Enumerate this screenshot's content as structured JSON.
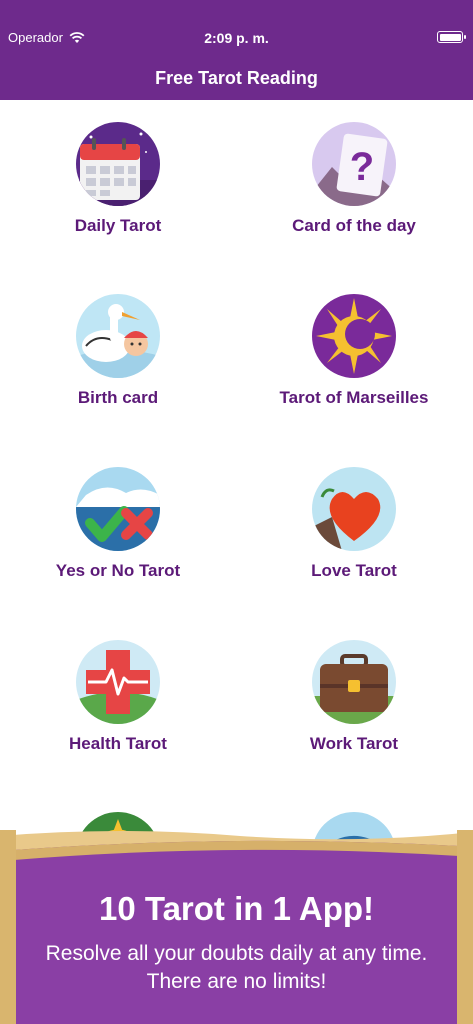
{
  "status_bar": {
    "carrier": "Operador",
    "time": "2:09 p. m."
  },
  "nav": {
    "title": "Free Tarot Reading"
  },
  "tiles": [
    {
      "label": "Daily Tarot"
    },
    {
      "label": "Card of the day"
    },
    {
      "label": "Birth card"
    },
    {
      "label": "Tarot of Marseilles"
    },
    {
      "label": "Yes or No Tarot"
    },
    {
      "label": "Love Tarot"
    },
    {
      "label": "Health Tarot"
    },
    {
      "label": "Work Tarot"
    }
  ],
  "banner": {
    "title": "10 Tarot in 1 App!",
    "subtitle_line1": "Resolve all your doubts daily at any time.",
    "subtitle_line2": "There are no limits!"
  },
  "colors": {
    "brand": "#6e2a8c",
    "label": "#5c1a78",
    "banner": "#8a3fa5",
    "scroll": "#e9c98a"
  }
}
